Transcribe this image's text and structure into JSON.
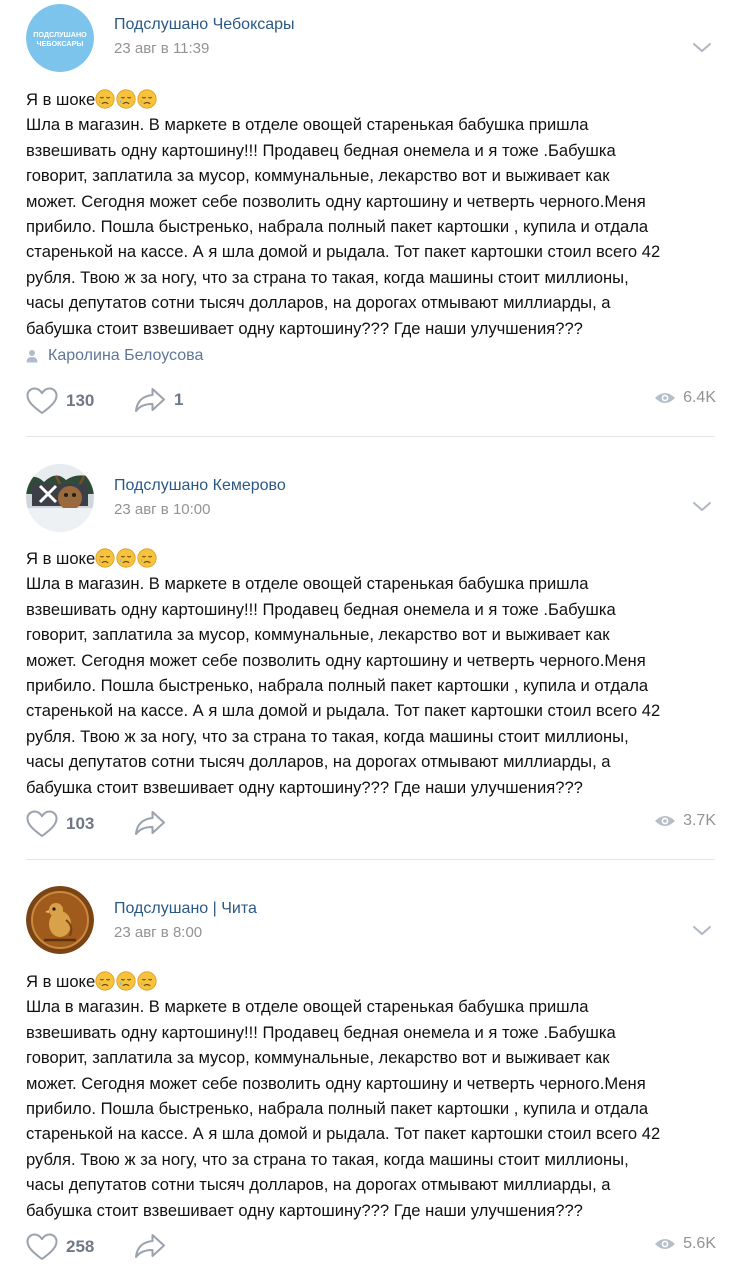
{
  "posts": [
    {
      "author": "Подслушано Чебоксары",
      "avatar_text": "ПОДСЛУШАНО ЧЕБОКСАРЫ",
      "date": "23 авг в 11:39",
      "lines": [
        "Я в шоке",
        "Шла в магазин. В маркете в отделе овощей старенькая бабушка пришла",
        "взвешивать одну картошину!!! Продавец бедная онемела и я тоже .Бабушка",
        "говорит, заплатила за мусор, коммунальные, лекарство вот и выживает как",
        "может. Сегодня может себе позволить одну картошину и четверть черного.Меня",
        "прибило. Пошла быстренько, набрала полный пакет картошки , купила и отдала",
        "старенькой на кассе. А я шла домой и рыдала. Тот пакет картошки стоил всего 42",
        "рубля. Твою ж за ногу, что за страна то такая, когда машины стоит миллионы,",
        "часы депутатов сотни тысяч долларов, на дорогах отмывают миллиарды, а",
        "бабушка стоит взвешивает одну картошину??? Где наши улучшения???"
      ],
      "signer": "Каролина Белоусова",
      "likes": "130",
      "shares": "1",
      "views": "6.4K"
    },
    {
      "author": "Подслушано Кемерово",
      "date": "23 авг в 10:00",
      "lines": [
        "Я в шоке",
        "Шла в магазин. В маркете в отделе овощей старенькая бабушка пришла",
        "взвешивать одну картошину!!! Продавец бедная онемела и я тоже .Бабушка",
        "говорит, заплатила за мусор, коммунальные, лекарство вот и выживает как",
        "может. Сегодня может себе позволить одну картошину и четверть черного.Меня",
        "прибило. Пошла быстренько, набрала полный пакет картошки , купила и отдала",
        "старенькой на кассе. А я шла домой и рыдала. Тот пакет картошки стоил всего 42",
        "рубля. Твою ж за ногу, что за страна то такая, когда машины стоит миллионы,",
        "часы депутатов сотни тысяч долларов, на дорогах отмывают миллиарды, а",
        "бабушка стоит взвешивает одну картошину??? Где наши улучшения???"
      ],
      "likes": "103",
      "views": "3.7K"
    },
    {
      "author": "Подслушано | Чита",
      "date": "23 авг в 8:00",
      "lines": [
        "Я в шоке",
        "Шла в магазин. В маркете в отделе овощей старенькая бабушка пришла",
        "взвешивать одну картошину!!! Продавец бедная онемела и я тоже .Бабушка",
        "говорит, заплатила за мусор, коммунальные, лекарство вот и выживает как",
        "может. Сегодня может себе позволить одну картошину и четверть черного.Меня",
        "прибило. Пошла быстренько, набрала полный пакет картошки , купила и отдала",
        "старенькой на кассе. А я шла домой и рыдала. Тот пакет картошки стоил всего 42",
        "рубля. Твою ж за ногу, что за страна то такая, когда машины стоит миллионы,",
        "часы депутатов сотни тысяч долларов, на дорогах отмывают миллиарды, а",
        "бабушка стоит взвешивает одну картошину??? Где наши улучшения???"
      ],
      "likes": "258",
      "views": "5.6K"
    }
  ],
  "icons": {
    "emoji": "sad-face-emoji",
    "like": "heart-icon",
    "share": "share-arrow-icon",
    "views": "eye-icon",
    "menu": "chevron-down-icon",
    "signer": "person-icon"
  },
  "colors": {
    "author_link": "#2a5885",
    "meta_gray": "#939393",
    "action_gray": "#6f7985",
    "signer": "#5e7796",
    "divider": "#e3e4e8"
  }
}
